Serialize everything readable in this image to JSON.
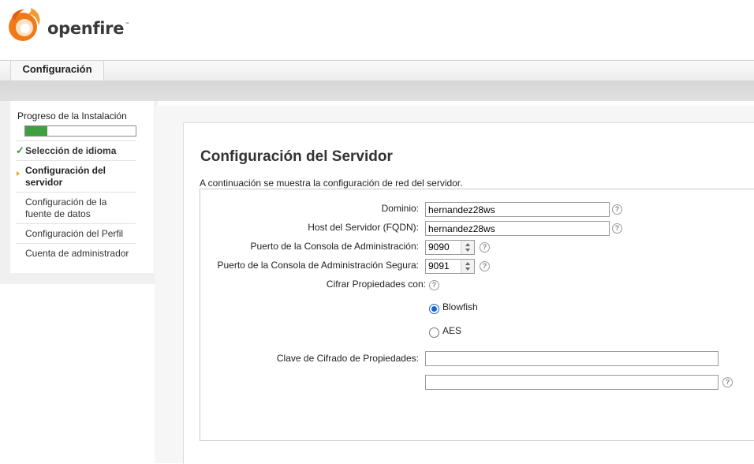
{
  "brand": {
    "name": "openfire",
    "tm": "™"
  },
  "nav": {
    "tab_label": "Configuración"
  },
  "sidebar": {
    "title": "Progreso de la Instalación",
    "progress_fraction": 0.2,
    "items": [
      {
        "label": "Selección de idioma",
        "state": "done"
      },
      {
        "label": "Configuración del servidor",
        "state": "current"
      },
      {
        "label": "Configuración de la fuente de datos",
        "state": "pending"
      },
      {
        "label": "Configuración del Perfil",
        "state": "pending"
      },
      {
        "label": "Cuenta de administrador",
        "state": "pending"
      }
    ]
  },
  "main": {
    "title": "Configuración del Servidor",
    "intro": "A continuación se muestra la configuración de red del servidor.",
    "form": {
      "domain_label": "Dominio:",
      "domain_value": "hernandez28ws",
      "host_label": "Host del Servidor (FQDN):",
      "host_value": "hernandez28ws",
      "admin_port_label": "Puerto de la Consola de Administración:",
      "admin_port_value": "9090",
      "admin_secure_port_label": "Puerto de la Consola de Administración Segura:",
      "admin_secure_port_value": "9091",
      "encrypt_label": "Cifrar Propiedades con:",
      "encrypt_options": [
        "Blowfish",
        "AES"
      ],
      "encrypt_selected": "Blowfish",
      "key_label": "Clave de Cifrado de Propiedades:",
      "key_value": "",
      "key_confirm_value": ""
    },
    "help_glyph": "?"
  },
  "colors": {
    "progress": "#3fa03f",
    "radio_selected": "#1a66c9",
    "current_arrow": "#e6a619"
  }
}
